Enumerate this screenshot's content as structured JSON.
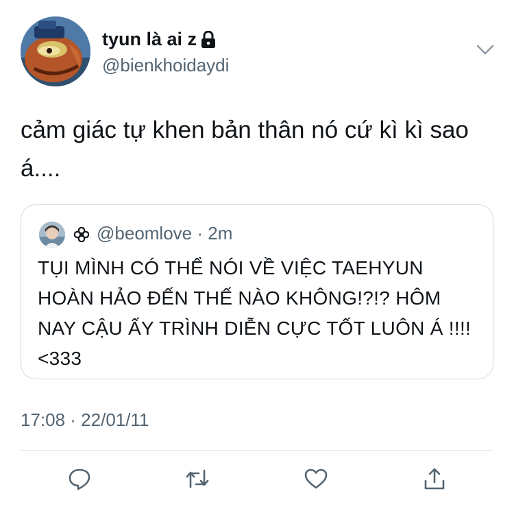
{
  "tweet": {
    "author": {
      "display_name": "tyun là ai z",
      "handle": "@bienkhoidaydi",
      "protected_icon": "lock-icon",
      "avatar_icon": "cartoon-fish-avatar"
    },
    "text": "cảm giác tự khen bản thân nó cứ kì kì sao á....",
    "timestamp": "17:08 · 22/01/11",
    "menu_icon": "chevron-down-icon"
  },
  "quoted_tweet": {
    "name_icon": "flower-icon",
    "handle": "@beomlove",
    "separator": "·",
    "time": "2m",
    "text": "TỤI MÌNH CÓ THỂ NÓI VỀ VIỆC TAEHYUN HOÀN HẢO ĐẾN THẾ NÀO KHÔNG!?!? HÔM NAY CẬU ẤY TRÌNH DIỄN CỰC TỐT LUÔN Á !!!! <333"
  },
  "actions": [
    "reply-icon",
    "retweet-icon",
    "like-icon",
    "share-icon"
  ],
  "colors": {
    "text": "#0f1419",
    "secondary": "#536471",
    "border": "#cfd9de",
    "icon": "#536471"
  }
}
